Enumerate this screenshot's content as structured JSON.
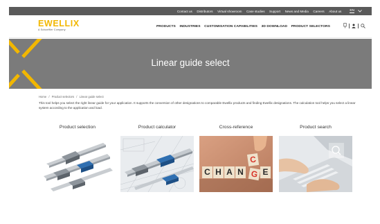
{
  "topbar": {
    "links": [
      "Contact us",
      "Distributors",
      "Virtual showroom",
      "Case studies",
      "Support",
      "News and Media",
      "Careers",
      "About us"
    ],
    "language": "EN"
  },
  "header": {
    "logo_text": "EWELLIX",
    "logo_sub": "A Schaeffler Company",
    "nav": [
      "PRODUCTS",
      "INDUSTRIES",
      "CUSTOMISATION CAPABILITIES",
      "3D DOWNLOAD",
      "PRODUCT SELECTORS"
    ]
  },
  "banner": {
    "title": "Linear guide select",
    "accent": "#f2b700"
  },
  "breadcrumb": [
    "Home",
    "/",
    "Product selectors",
    "/",
    "Linear guide select"
  ],
  "intro": "This tool helps you select the right linear guide for your application. It supports the conversion of other designations to comparable Ewellix products and finding Ewellix designations. The calculation tool helps you select a linear system according to the application and load.",
  "cards": [
    {
      "title": "Product selection"
    },
    {
      "title": "Product calculator"
    },
    {
      "title": "Cross-reference",
      "letters": [
        "C",
        "H",
        "A",
        "N",
        "C",
        "G",
        "E"
      ]
    },
    {
      "title": "Product search"
    }
  ]
}
